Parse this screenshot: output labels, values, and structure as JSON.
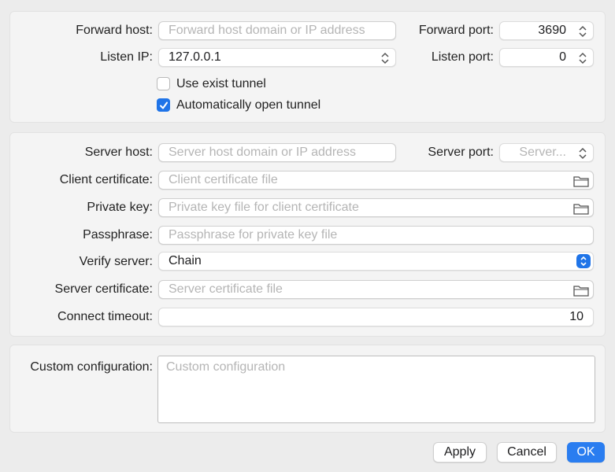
{
  "forward": {
    "host_label": "Forward host:",
    "host_placeholder": "Forward host domain or IP address",
    "port_label": "Forward port:",
    "port_value": "3690",
    "listen_ip_label": "Listen IP:",
    "listen_ip_value": "127.0.0.1",
    "listen_port_label": "Listen port:",
    "listen_port_value": "0",
    "use_exist_tunnel_label": "Use exist tunnel",
    "use_exist_tunnel_checked": false,
    "auto_open_tunnel_label": "Automatically open tunnel",
    "auto_open_tunnel_checked": true
  },
  "server": {
    "host_label": "Server host:",
    "host_placeholder": "Server host domain or IP address",
    "port_label": "Server port:",
    "port_placeholder": "Server...",
    "client_cert_label": "Client certificate:",
    "client_cert_placeholder": "Client certificate file",
    "private_key_label": "Private key:",
    "private_key_placeholder": "Private key file for client certificate",
    "passphrase_label": "Passphrase:",
    "passphrase_placeholder": "Passphrase for private key file",
    "verify_label": "Verify server:",
    "verify_value": "Chain",
    "server_cert_label": "Server certificate:",
    "server_cert_placeholder": "Server certificate file",
    "timeout_label": "Connect timeout:",
    "timeout_value": "10"
  },
  "custom": {
    "label": "Custom configuration:",
    "placeholder": "Custom configuration"
  },
  "buttons": {
    "apply": "Apply",
    "cancel": "Cancel",
    "ok": "OK"
  },
  "colors": {
    "accent": "#2a7df0",
    "panel": "#f4f4f4",
    "background": "#ececec"
  },
  "icons": [
    "stepper-icon",
    "folder-icon",
    "checkmark-icon",
    "popup-chevron-icon"
  ]
}
